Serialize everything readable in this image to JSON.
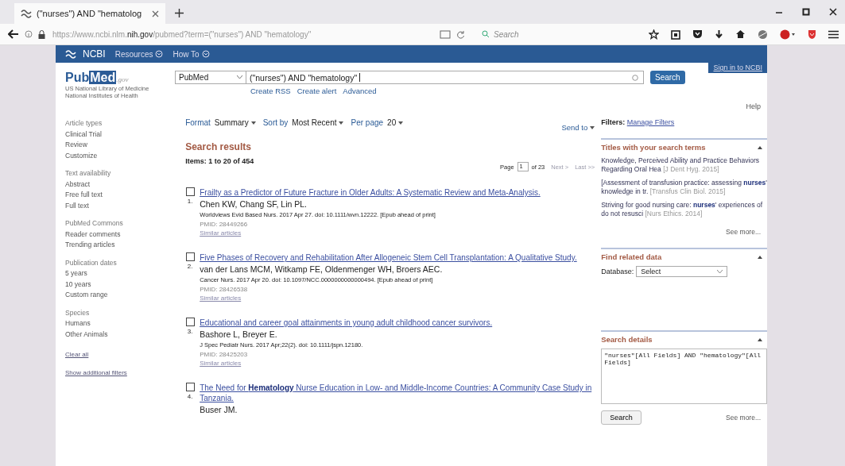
{
  "browser": {
    "tab_title": "(\"nurses\") AND \"hematolog",
    "url": "https://www.ncbi.nlm.**nih.gov**/pubmed?term=(\"nurses\") AND \"hematology\"",
    "search_placeholder": "Search"
  },
  "ncbi_bar": {
    "logo": "NCBI",
    "menus": [
      "Resources",
      "How To"
    ],
    "sign_in": "Sign in to NCBI"
  },
  "header": {
    "logo": "Pub",
    "logo_med": "Med",
    "logo_suffix": ".gov",
    "org_lines": [
      "US National Library of Medicine",
      "National Institutes of Health"
    ],
    "database": "PubMed",
    "query": "(\"nurses\") AND \"hematology\"",
    "links": [
      "Create RSS",
      "Create alert",
      "Advanced"
    ],
    "search_button": "Search",
    "help": "Help"
  },
  "sidebar": {
    "groups": [
      {
        "heading": "Article types",
        "items": [
          "Clinical Trial",
          "Review",
          "Customize"
        ]
      },
      {
        "heading": "Text availability",
        "items": [
          "Abstract",
          "Free full text",
          "Full text"
        ]
      },
      {
        "heading": "PubMed Commons",
        "items": [
          "Reader comments",
          "Trending articles"
        ]
      },
      {
        "heading": "Publication dates",
        "items": [
          "5 years",
          "10 years",
          "Custom range"
        ]
      },
      {
        "heading": "Species",
        "items": [
          "Humans",
          "Other Animals"
        ]
      }
    ],
    "clear_all": "Clear all",
    "show_filters": "Show additional filters"
  },
  "toolbar": [
    {
      "label": "Format",
      "value": "Summary"
    },
    {
      "label": "Sort by",
      "value": "Most Recent"
    },
    {
      "label": "Per page",
      "value": "20"
    }
  ],
  "send_to": "Send to",
  "results": {
    "heading": "Search results",
    "count": "Items: 1 to 20 of 454",
    "pager": {
      "page_label": "Page",
      "page": "1",
      "of": "of 23",
      "next": "Next >",
      "last": "Last >>"
    },
    "items": [
      {
        "number": "1.",
        "checked": false,
        "title": "Frailty as a Predictor of Future Fracture in Older Adults: A Systematic Review and Meta-Analysis.",
        "authors": "Chen KW, Chang SF, Lin PL.",
        "citation": "Worldviews Evid Based Nurs. 2017 Apr 27. doi: 10.1111/wvn.12222. [Epub ahead of print]",
        "pmid": "PMID: 28449266",
        "similar": "Similar articles"
      },
      {
        "number": "2.",
        "checked": false,
        "title": "Five Phases of Recovery and Rehabilitation After Allogeneic Stem Cell Transplantation: A Qualitative Study.",
        "authors": "van der Lans MCM, Witkamp FE, Oldenmenger WH, Broers AEC.",
        "citation": "Cancer Nurs. 2017 Apr 20. doi: 10.1097/NCC.0000000000000494. [Epub ahead of print]",
        "pmid": "PMID: 28426538",
        "similar": "Similar articles"
      },
      {
        "number": "3.",
        "checked": false,
        "title": "Educational and career goal attainments in young adult childhood cancer survivors.",
        "authors": "Bashore L, Breyer E.",
        "citation": "J Spec Pediatr Nurs. 2017 Apr;22(2). doi: 10.1111/jspn.12180.",
        "pmid": "PMID: 28425203",
        "similar": "Similar articles"
      },
      {
        "number": "4.",
        "checked": false,
        "title": "The Need for **Hematology** Nurse Education in Low- and Middle-Income Countries: A Community Case Study in Tanzania.",
        "authors": "Buser JM."
      }
    ]
  },
  "filters": {
    "label": "Filters:",
    "link": "Manage Filters"
  },
  "titles_panel": {
    "heading": "Titles with your search terms",
    "items": [
      {
        "title": "Knowledge, Perceived Ability and Practice Behaviors Regarding Oral Hea",
        "source": "[J Dent Hyg. 2015]"
      },
      {
        "title": "[Assessment of transfusion practice: assessing **nurses**' knowledge in tr.",
        "source": "[Transfus Clin Biol. 2015]"
      },
      {
        "title": "Striving for good nursing care: **nurses**' experiences of do not resusci",
        "source": "[Nurs Ethics. 2014]"
      }
    ],
    "see_more": "See more..."
  },
  "related_panel": {
    "heading": "Find related data",
    "database_label": "Database:",
    "database_value": "Select"
  },
  "details_panel": {
    "heading": "Search details",
    "text": "\"nurses\"[All Fields] AND \"hematology\"[All Fields]",
    "button": "Search",
    "see_more": "See more..."
  }
}
